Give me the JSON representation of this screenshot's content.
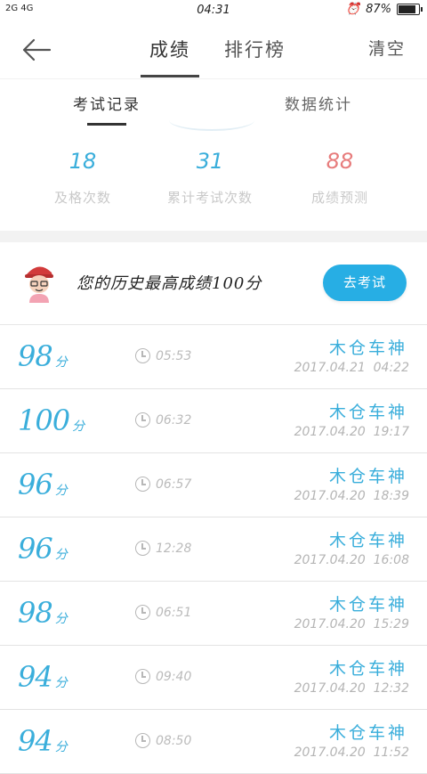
{
  "status_bar": {
    "signal": "2G 4G",
    "time": "04:31",
    "battery": "87%"
  },
  "nav": {
    "tab_scores": "成绩",
    "tab_rank": "排行榜",
    "clear": "清空"
  },
  "subtabs": {
    "records": "考试记录",
    "stats": "数据统计"
  },
  "stats": [
    {
      "value": "18",
      "label": "及格次数"
    },
    {
      "value": "31",
      "label": "累计考试次数"
    },
    {
      "value": "88",
      "label": "成绩预测"
    }
  ],
  "best": {
    "text": "您的历史最高成绩100分",
    "button": "去考试"
  },
  "records": [
    {
      "score": "98",
      "unit": "分",
      "duration": "05:53",
      "title": "木仓车神",
      "date": "2017.04.21  04:22"
    },
    {
      "score": "100",
      "unit": "分",
      "duration": "06:32",
      "title": "木仓车神",
      "date": "2017.04.20  19:17"
    },
    {
      "score": "96",
      "unit": "分",
      "duration": "06:57",
      "title": "木仓车神",
      "date": "2017.04.20  18:39"
    },
    {
      "score": "96",
      "unit": "分",
      "duration": "12:28",
      "title": "木仓车神",
      "date": "2017.04.20  16:08"
    },
    {
      "score": "98",
      "unit": "分",
      "duration": "06:51",
      "title": "木仓车神",
      "date": "2017.04.20  15:29"
    },
    {
      "score": "94",
      "unit": "分",
      "duration": "09:40",
      "title": "木仓车神",
      "date": "2017.04.20  12:32"
    },
    {
      "score": "94",
      "unit": "分",
      "duration": "08:50",
      "title": "木仓车神",
      "date": "2017.04.20  11:52"
    }
  ],
  "colors": {
    "accent": "#3aaedb",
    "button": "#27aee4",
    "prediction": "#e77c7c"
  }
}
